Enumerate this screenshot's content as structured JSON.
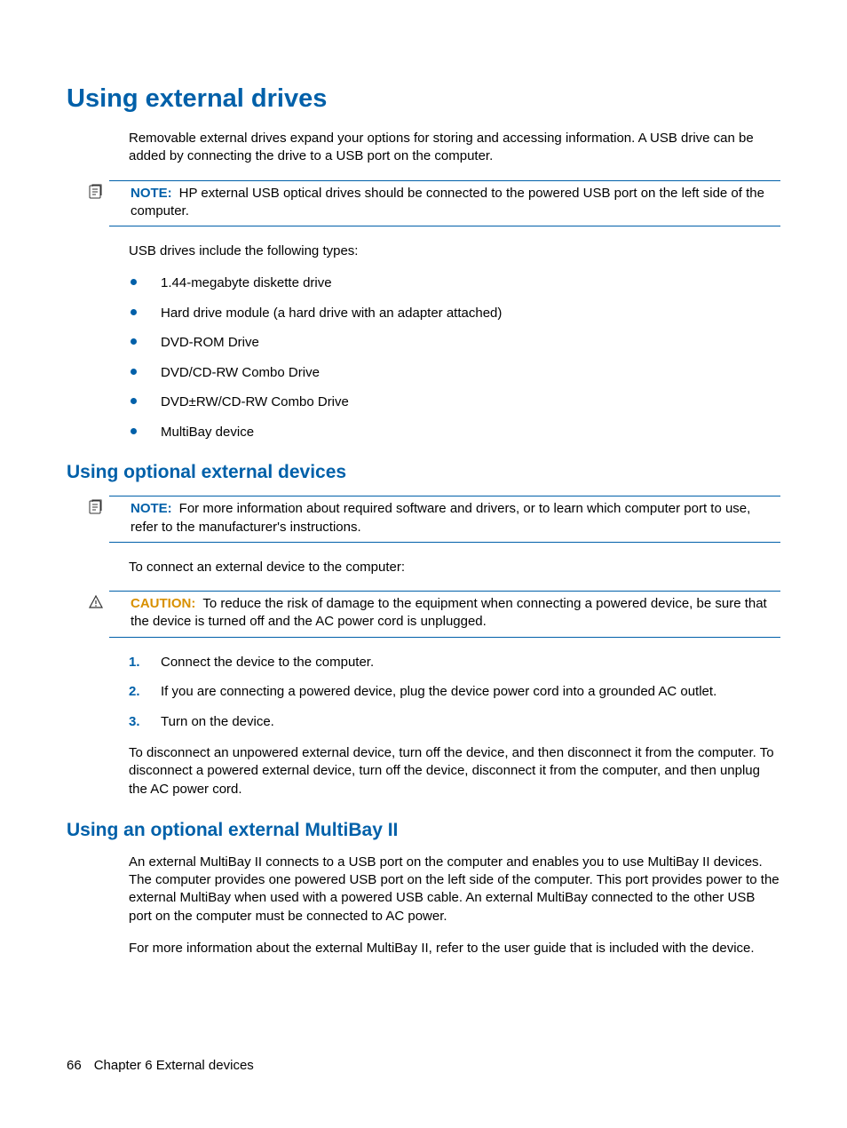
{
  "heading1": "Using external drives",
  "intro_p1": "Removable external drives expand your options for storing and accessing information. A USB drive can be added by connecting the drive to a USB port on the computer.",
  "note1": {
    "label": "NOTE:",
    "text": "HP external USB optical drives should be connected to the powered USB port on the left side of the computer."
  },
  "usb_types_intro": "USB drives include the following types:",
  "usb_types": [
    "1.44-megabyte diskette drive",
    "Hard drive module (a hard drive with an adapter attached)",
    "DVD-ROM Drive",
    "DVD/CD-RW Combo Drive",
    "DVD±RW/CD-RW Combo Drive",
    "MultiBay device"
  ],
  "heading2a": "Using optional external devices",
  "note2": {
    "label": "NOTE:",
    "text": "For more information about required software and drivers, or to learn which computer port to use, refer to the manufacturer's instructions."
  },
  "connect_intro": "To connect an external device to the computer:",
  "caution": {
    "label": "CAUTION:",
    "text": "To reduce the risk of damage to the equipment when connecting a powered device, be sure that the device is turned off and the AC power cord is unplugged."
  },
  "steps": [
    "Connect the device to the computer.",
    "If you are connecting a powered device, plug the device power cord into a grounded AC outlet.",
    "Turn on the device."
  ],
  "disconnect_p": "To disconnect an unpowered external device, turn off the device, and then disconnect it from the computer. To disconnect a powered external device, turn off the device, disconnect it from the computer, and then unplug the AC power cord.",
  "heading2b": "Using an optional external MultiBay II",
  "multibay_p1": "An external MultiBay II connects to a USB port on the computer and enables you to use MultiBay II devices. The computer provides one powered USB port on the left side of the computer. This port provides power to the external MultiBay when used with a powered USB cable. An external MultiBay connected to the other USB port on the computer must be connected to AC power.",
  "multibay_p2": "For more information about the external MultiBay II, refer to the user guide that is included with the device.",
  "footer": {
    "page": "66",
    "chapter": "Chapter 6   External devices"
  }
}
